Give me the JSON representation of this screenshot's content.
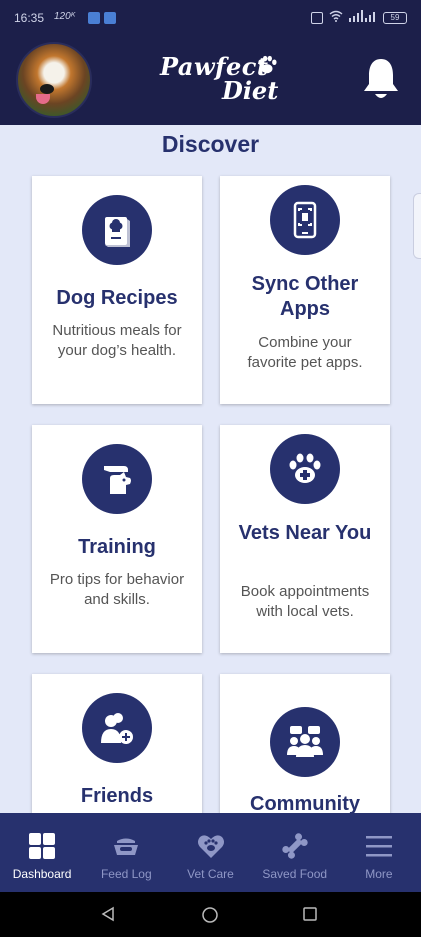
{
  "status_bar": {
    "time": "16:35",
    "network": "120ᴷ",
    "battery": "59"
  },
  "header": {
    "logo_line1": "Pawfect",
    "logo_line2": "Diet"
  },
  "page_title": "Discover",
  "cards": [
    {
      "title": "Dog Recipes",
      "desc": "Nutritious meals for your dog’s health.",
      "icon": "recipe-book-icon"
    },
    {
      "title": "Sync Other Apps",
      "desc": "Combine your favorite pet apps.",
      "icon": "phone-scan-icon"
    },
    {
      "title": "Training",
      "desc": "Pro tips for behavior and skills.",
      "icon": "hand-dog-icon"
    },
    {
      "title": "Vets Near You",
      "desc": "Book appointments with local vets.",
      "icon": "paw-plus-icon"
    },
    {
      "title": "Friends",
      "desc": "",
      "icon": "add-friend-icon"
    },
    {
      "title": "Community",
      "desc": "",
      "icon": "community-icon"
    }
  ],
  "nav": [
    {
      "label": "Dashboard",
      "icon": "dashboard-icon",
      "active": true
    },
    {
      "label": "Feed Log",
      "icon": "food-bowl-icon",
      "active": false
    },
    {
      "label": "Vet Care",
      "icon": "heart-paw-icon",
      "active": false
    },
    {
      "label": "Saved Food",
      "icon": "bone-icon",
      "active": false
    },
    {
      "label": "More",
      "icon": "menu-icon",
      "active": false
    }
  ],
  "colors": {
    "navy": "#1c1f4a",
    "accent": "#27316e",
    "background": "#e3e8f8"
  }
}
